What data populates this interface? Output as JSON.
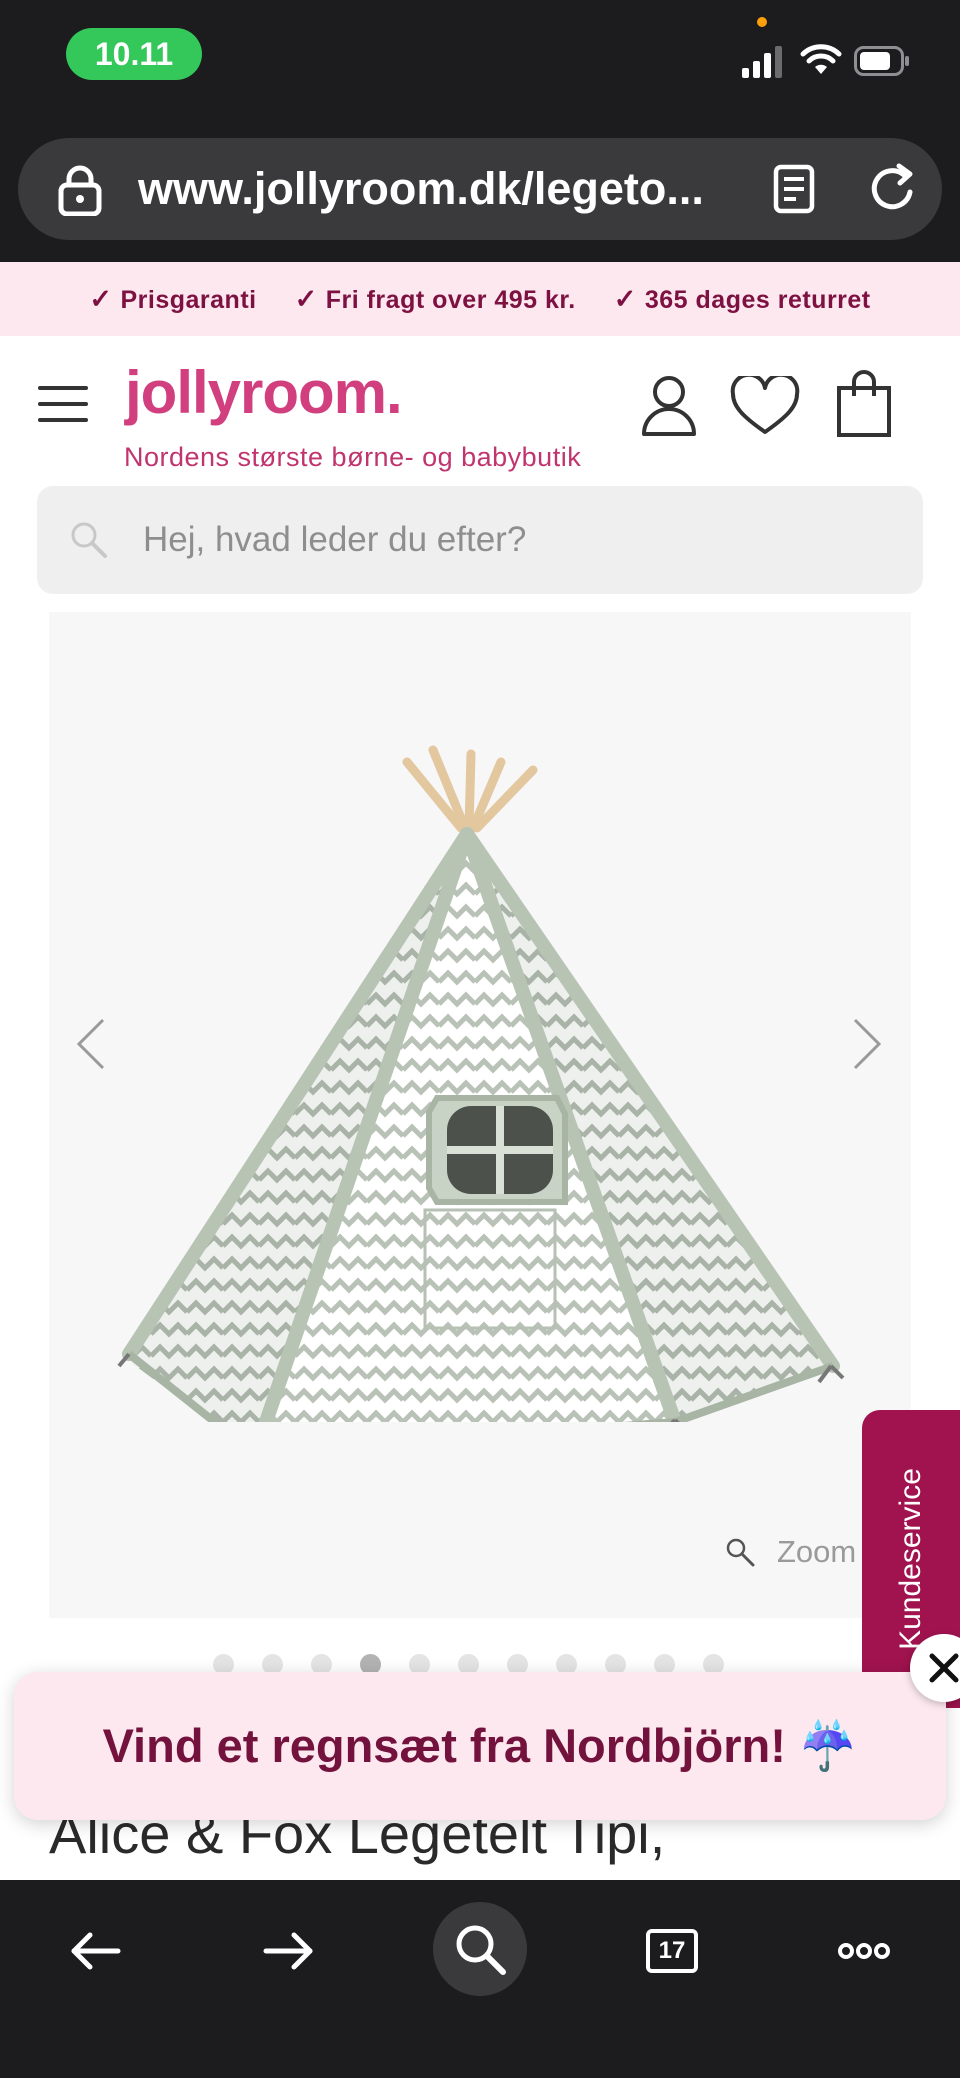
{
  "status_bar": {
    "time": "10.11",
    "signal_icon": "cellular-signal-icon",
    "wifi_icon": "wifi-icon",
    "battery_icon": "battery-icon"
  },
  "browser": {
    "url": "www.jollyroom.dk/legeto...",
    "lock_icon": "lock-icon",
    "reader_icon": "reader-mode-icon",
    "reload_icon": "reload-icon"
  },
  "usp_bar": {
    "items": [
      {
        "label": "Prisgaranti"
      },
      {
        "label": "Fri fragt over 495 kr."
      },
      {
        "label": "365 dages returret"
      }
    ]
  },
  "header": {
    "logo": "jollyroom.",
    "tagline": "Nordens største børne- og babybutik"
  },
  "search": {
    "placeholder": "Hej, hvad leder du efter?",
    "value": ""
  },
  "gallery": {
    "zoom_label": "Zoom",
    "dot_count": 11,
    "active_dot": 4
  },
  "product": {
    "title": "Alice & Fox Legetelt Tipi, Grøn/Hvid"
  },
  "kundeservice": {
    "label": "Kundeservice"
  },
  "promo": {
    "text": "Vind et regnsæt fra Nordbjörn! ☔"
  },
  "toolbar": {
    "tabs_count": "17"
  },
  "colors": {
    "brand_pink": "#d13f7e",
    "brand_dark": "#74123e",
    "usp_bg": "#fce8ee",
    "kundeservice_bg": "#a1134f",
    "status_green": "#34c759"
  }
}
